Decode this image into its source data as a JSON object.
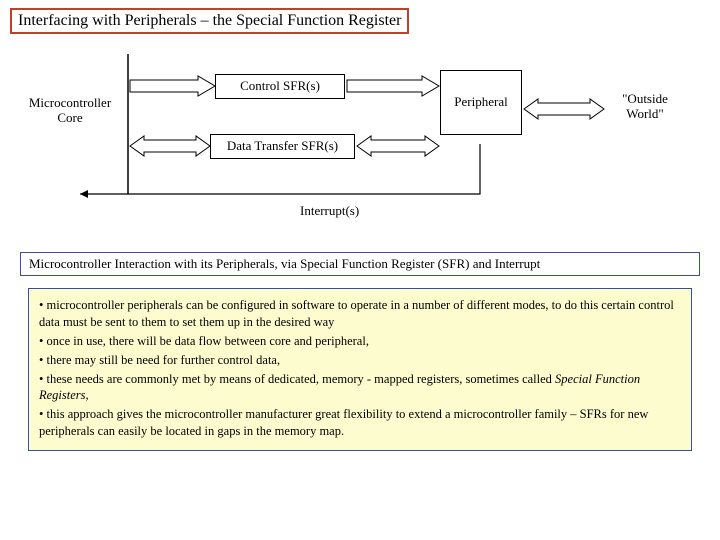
{
  "title": "Interfacing with Peripherals – the Special Function Register",
  "diagram": {
    "core_label_1": "Microcontroller",
    "core_label_2": "Core",
    "control_sfr": "Control SFR(s)",
    "data_sfr": "Data Transfer SFR(s)",
    "peripheral": "Peripheral",
    "outside_1": "\"Outside",
    "outside_2": "World\"",
    "interrupts": "Interrupt(s)"
  },
  "caption": "Microcontroller Interaction with its Peripherals, via Special Function Register (SFR) and Interrupt",
  "bullets": [
    "microcontroller peripherals can be configured in software to operate in a number of different modes, to do this certain control data must be sent to them to set them up in the desired way",
    "once in use, there will be data flow between core and peripheral,",
    "there may still be need for further control data,",
    "these needs are commonly met by means of dedicated, memory - mapped registers, sometimes called ",
    "this approach gives the microcontroller manufacturer great flexibility to extend a microcontroller family – SFRs for new peripherals can easily be located in gaps in the memory map."
  ],
  "sfr_em": "Special Function Registers"
}
